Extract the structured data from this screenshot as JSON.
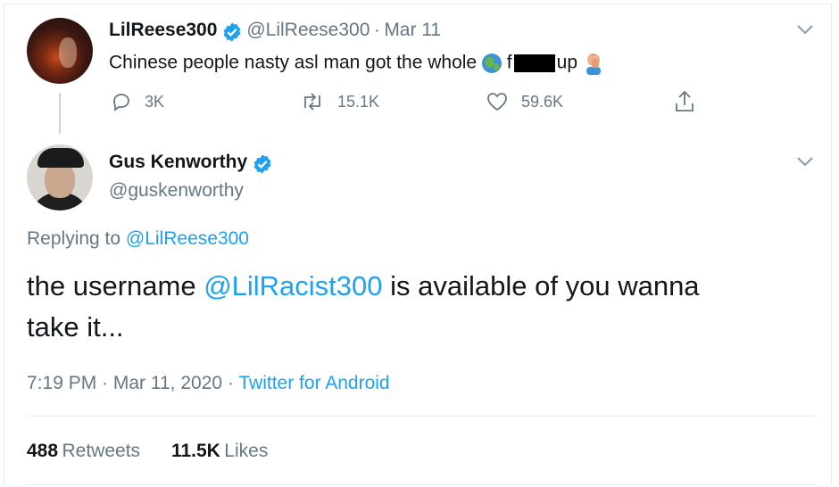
{
  "tweet1": {
    "name": "LilReese300",
    "handle": "@LilReese300",
    "sep": "·",
    "date": "Mar 11",
    "text_before": "Chinese people nasty asl man got the whole",
    "text_f": "f",
    "text_after": "up",
    "replies": "3K",
    "retweets": "15.1K",
    "likes": "59.6K"
  },
  "tweet2": {
    "name": "Gus Kenworthy",
    "handle": "@guskenworthy",
    "replying_to_label": "Replying to",
    "replying_to_handle": "@LilReese300",
    "text_line1_before": "the username",
    "text_mention": "@LilRacist300",
    "text_line1_after": "is available of you wanna",
    "text_line2": "take it...",
    "timestamp": "7:19 PM · Mar 11, 2020",
    "sep": "·",
    "source": "Twitter for Android",
    "retweet_count": "488",
    "retweet_label": "Retweets",
    "like_count": "11.5K",
    "like_label": "Likes"
  },
  "colors": {
    "accent": "#1da1f2",
    "muted": "#657786",
    "text": "#14171a"
  },
  "icons": [
    "verified-badge-icon",
    "chevron-down-icon",
    "reply-icon",
    "retweet-icon",
    "like-icon",
    "share-icon",
    "globe-emoji-icon",
    "facepalm-emoji-icon"
  ]
}
